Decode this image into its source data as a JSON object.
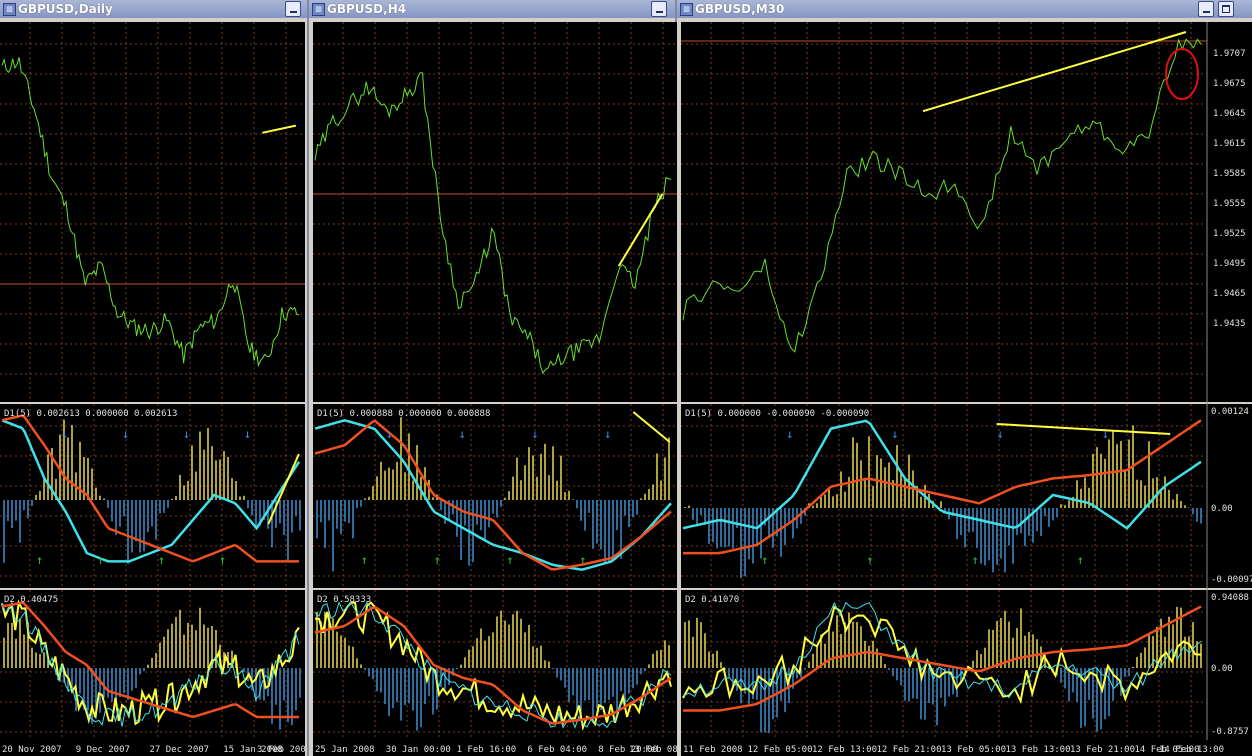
{
  "windows": [
    {
      "title": "GBPUSD,Daily",
      "buttons": [
        "minimize"
      ],
      "price_labels": [],
      "d1_label": "D1(5) 0.002613 0.000000 0.002613",
      "d2_label": "D2 0.40475",
      "d1_axis": [],
      "d2_axis": [],
      "time_labels": [
        "20 Nov 2007",
        "9 Dec 2007",
        "27 Dec 2007",
        "15 Jan 2008",
        "3 Feb 2008"
      ]
    },
    {
      "title": "GBPUSD,H4",
      "buttons": [
        "minimize"
      ],
      "price_labels": [],
      "d1_label": "D1(5) 0.000888 0.000000 0.000888",
      "d2_label": "D2 0.58333",
      "d1_axis": [],
      "d2_axis": [],
      "time_labels": [
        "25 Jan 2008",
        "30 Jan 00:00",
        "1 Feb 16:00",
        "6 Feb 04:00",
        "8 Feb 20:00",
        "13 Feb 08:"
      ]
    },
    {
      "title": "GBPUSD,M30",
      "buttons": [
        "minimize",
        "maximize"
      ],
      "price_labels": [
        "1.9707",
        "1.9675",
        "1.9645",
        "1.9615",
        "1.9585",
        "1.9555",
        "1.9525",
        "1.9495",
        "1.9465",
        "1.9435"
      ],
      "d1_label": "D1(5) 0.000000 -0.000090 -0.000090",
      "d2_label": "D2 0.41070",
      "d1_axis": [
        "0.00124",
        "0.00",
        "-0.00097"
      ],
      "d2_axis": [
        "0.94088",
        "0.00",
        "-0.8757"
      ],
      "time_labels": [
        "11 Feb 2008",
        "12 Feb 05:00",
        "12 Feb 13:00",
        "12 Feb 21:00",
        "13 Feb 05:00",
        "13 Feb 13:00",
        "13 Feb 21:00",
        "14 Feb 05:00",
        "14 Feb 13:00"
      ]
    }
  ],
  "colors": {
    "background": "#000000",
    "grid": "#7a3a1a",
    "price_line": "#66e030",
    "level_line": "#c05030",
    "trend_line": "#ffff40",
    "histogram_up": "#e8d850",
    "histogram_down": "#3f8fd0",
    "signal_cyan": "#40e0e8",
    "signal_red": "#f05020",
    "arrow_blue": "#3f8fe8",
    "arrow_green": "#30c040",
    "highlight_circle": "#e01010",
    "axis_text": "#e0e0e0"
  }
}
